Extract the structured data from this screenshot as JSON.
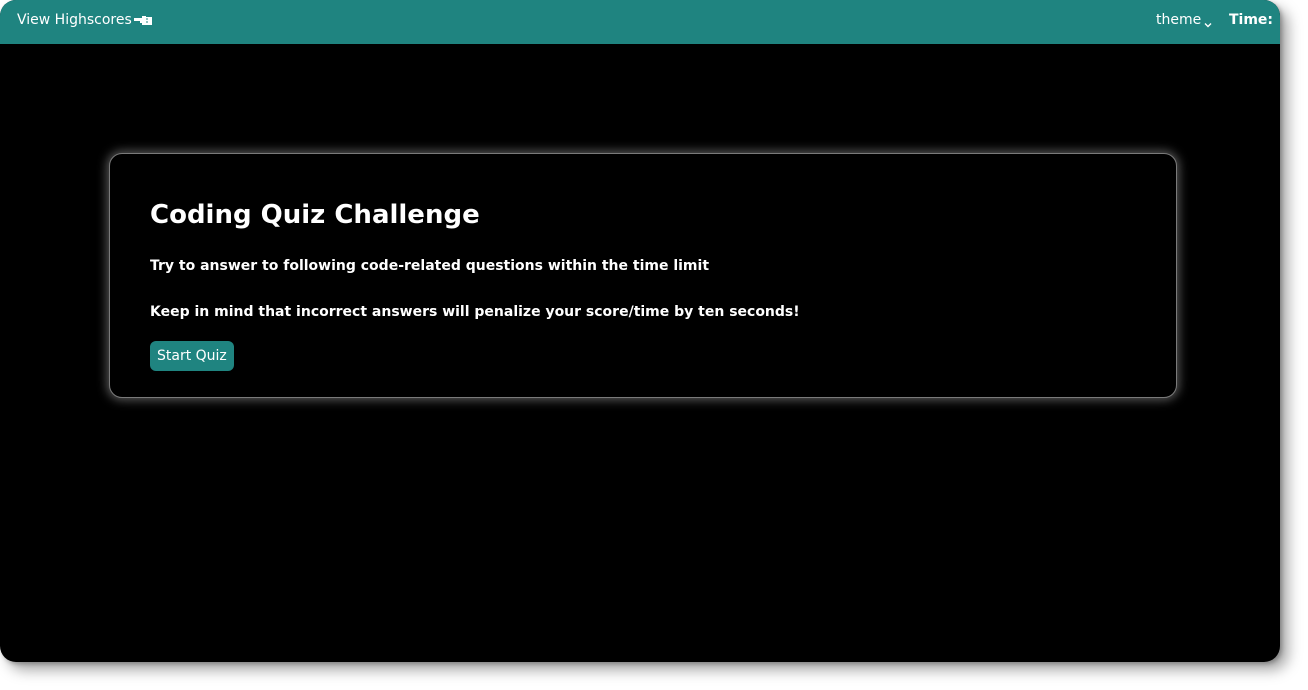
{
  "colors": {
    "accent": "#1f8480",
    "background": "#000000",
    "text": "#ffffff",
    "card_border": "#7a7a7a"
  },
  "header": {
    "highscores_label": "View Highscores",
    "highscores_icon": "pointing-hand-icon",
    "theme_label": "theme",
    "theme_icon": "chevron-down-icon",
    "time_label": "Time:"
  },
  "card": {
    "title": "Coding Quiz Challenge",
    "instruction": "Try to answer to following code-related questions within the time limit",
    "warning": "Keep in mind that incorrect answers will penalize your score/time by ten seconds!",
    "start_button": "Start Quiz"
  }
}
